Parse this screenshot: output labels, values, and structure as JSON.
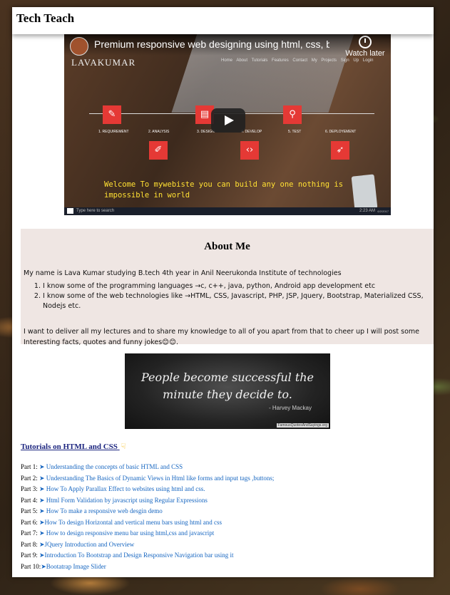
{
  "site": {
    "title": "Tech Teach"
  },
  "video": {
    "title": "Premium responsive web designing using html, css, boots...",
    "watch_later": "Watch later",
    "brand": "LAVAKUMAR",
    "nav": "Home About Tutorials Features Contact My Projects Sign Up Login",
    "steps": [
      "1. REQUIREMENT",
      "2. ANALYSIS",
      "3. DESIGN",
      "4. DEVELOP",
      "5. TEST",
      "6. DEPLOYEMENT"
    ],
    "welcome": "Welcome To mywebiste you can build any one nothing is impossible in world",
    "taskbar_search": "Type here to search",
    "taskbar_time": "2:23 AM",
    "taskbar_date": "6/2/2017"
  },
  "about": {
    "heading": "About Me",
    "intro": "My name is Lava Kumar studying B.tech 4th year in Anil Neerukonda Institute of technologies",
    "items": [
      "I know some of the programming languages →c, c++, java, python, Android app development etc",
      "I know some of the web technologies like →HTML, CSS, Javascript, PHP, JSP, Jquery, Bootstrap, Materialized CSS, Nodejs etc."
    ],
    "closing": "I want to deliver all my lectures and to share my knowledge to all of you apart from that to cheer up I will post some Interesting facts, quotes and funny jokes😊😊."
  },
  "quote": {
    "text_line1": "People become successful the",
    "text_line2": "minute they decide to.",
    "author": "- Harvey Mackay",
    "source": "FamousQuotesAndSayings.org"
  },
  "tutorials": {
    "heading": "Tutorials on HTML and CSS",
    "parts": [
      {
        "label": "Part 1:",
        "link": "➤ Understanding the concepts of basic HTML and CSS"
      },
      {
        "label": "Part 2:",
        "link": "➤ Understanding The Basics of Dynamic Views in Html like forms and input tags ,buttons;"
      },
      {
        "label": "Part 3:",
        "link": "➤ How To Apply Parallax Effect to websites using html and css."
      },
      {
        "label": "Part 4:",
        "link": "➤ Html Form Validation by javascript using Regular Expressions"
      },
      {
        "label": "Part 5:",
        "link": "➤ How To make a responsive web desgin demo"
      },
      {
        "label": "Part 6:",
        "link": "➤How To design Horizontal and vertical menu bars using html and css"
      },
      {
        "label": "Part 7:",
        "link": "➤ How to design responsive menu bar using html,css and javascript"
      },
      {
        "label": "Part 8:",
        "link": "➤JQuery Introduction and Overview"
      },
      {
        "label": "Part 9:",
        "link": "➤Introduction To Bootstrap and Design Responsive Navigation bar using it"
      },
      {
        "label": "Part 10:",
        "link": "➤Bootatrap Image Slider"
      }
    ]
  },
  "colors": {
    "link": "#1565c0",
    "about_bg": "#efe6e3",
    "step_red": "#e53935",
    "welcome_yellow": "#ffe033"
  }
}
